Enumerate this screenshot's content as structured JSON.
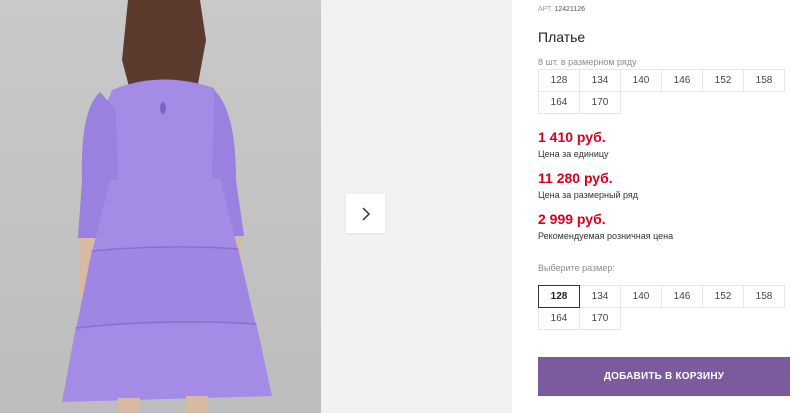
{
  "product": {
    "article_label": "АРТ.",
    "article": "12421126",
    "title": "Платье"
  },
  "size_row": {
    "label": "8 шт. в размерном ряду",
    "sizes": [
      "128",
      "134",
      "140",
      "146",
      "152",
      "158",
      "164",
      "170"
    ]
  },
  "prices": {
    "unit_price": "1 410 руб.",
    "unit_label": "Цена за единицу",
    "row_price": "11 280 руб.",
    "row_label": "Цена за размерный ряд",
    "retail_price": "2 999 руб.",
    "retail_label": "Рекомендуемая розничная цена"
  },
  "size_select": {
    "label": "Выберите размер:",
    "sizes": [
      "128",
      "134",
      "140",
      "146",
      "152",
      "158",
      "164",
      "170"
    ],
    "selected": "128"
  },
  "cart_button": "ДОБАВИТЬ В КОРЗИНУ",
  "colors": {
    "price": "#d6001c",
    "button": "#7c5a9e",
    "dress": "#a48be6"
  },
  "icons": {
    "next": "chevron-right-icon"
  }
}
